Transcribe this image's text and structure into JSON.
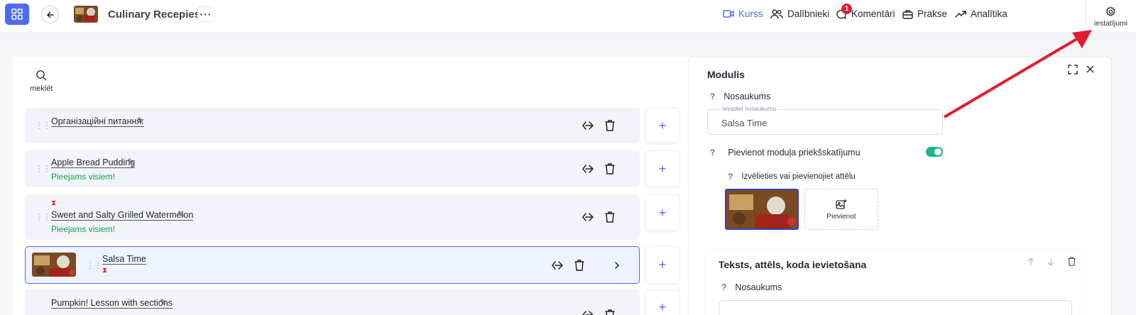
{
  "header": {
    "course_title": "Culinary Recepies",
    "more_label": "···",
    "nav": [
      {
        "label": "Kurss",
        "icon": "video-icon",
        "active": true
      },
      {
        "label": "Dalībnieki",
        "icon": "users-icon"
      },
      {
        "label": "Komentāri",
        "icon": "comment-icon",
        "badge": "1"
      },
      {
        "label": "Prakse",
        "icon": "briefcase-icon"
      },
      {
        "label": "Analītika",
        "icon": "trend-icon"
      }
    ],
    "settings_label": "iestatījumi"
  },
  "left": {
    "search_label": "meklēt",
    "lessons": [
      {
        "title": "Організаційні питання:"
      },
      {
        "title": "Apple Bread Pudding",
        "availability": "Pieejams visiem!"
      },
      {
        "title": "Sweet and Salty Grilled Watermelon",
        "availability": "Pieejams visiem!"
      },
      {
        "title": "Salsa Time"
      },
      {
        "title": "Pumpkin! Lesson with sections"
      }
    ],
    "add_label": "+"
  },
  "right": {
    "title": "Modulis",
    "name_label": "Nosaukums",
    "name_placeholder": "Ievadiet nosaukumu",
    "name_value": "Salsa Time",
    "preview_label": "Pievienot moduļa priekšskatījumu",
    "image_label": "Izvēlieties vai pievienojiet attēlu",
    "add_image_label": "Pievienot",
    "q_mark": "?",
    "section": {
      "title": "Teksts, attēls, koda ievietošana",
      "name_label": "Nosaukums"
    }
  },
  "colors": {
    "accent": "#4f6bed",
    "success": "#15a34a",
    "danger": "#e11d2e",
    "toggle": "#1db58a"
  }
}
